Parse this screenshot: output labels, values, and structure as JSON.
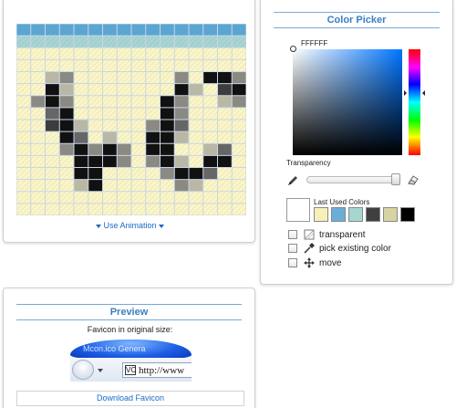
{
  "editor": {
    "use_animation_label": "Use Animation",
    "grid": {
      "cols": 16,
      "rows": 16,
      "background_rows": [
        "blue",
        "teal",
        "cream",
        "cream",
        "cream",
        "cream",
        "cream",
        "cream",
        "cream",
        "cream",
        "cream",
        "cream",
        "cream",
        "cream",
        "cream",
        "cream"
      ],
      "pixels": [
        "................",
        "................",
        "................",
        "................",
        "..HG.......G.KKG",
        "..KH.......KH.LK",
        ".GKG......KG..HG",
        "..MK......KG....",
        "..LKH....GKM....",
        "...KM.H..KKH....",
        "...GKGKG.KK..HM.",
        "....KKKG.GKH.KK.",
        "....KK....GKKM..",
        "....HK.....GH...",
        "................",
        "................"
      ]
    }
  },
  "picker": {
    "title": "Color Picker",
    "hex_value": "FFFFFF",
    "transparency_label": "Transparency",
    "last_used_label": "Last Used Colors",
    "last_used_colors": [
      "#f6f0b9",
      "#6aaed8",
      "#a5d6d0",
      "#3f3f3f",
      "#d7d4a3",
      "#000000"
    ],
    "options": [
      {
        "label": "transparent",
        "icon": "transparent-icon"
      },
      {
        "label": "pick existing color",
        "icon": "eyedropper-icon"
      },
      {
        "label": "move",
        "icon": "move-icon"
      }
    ]
  },
  "preview": {
    "title": "Preview",
    "favicon_label": "Favicon in original size:",
    "browser_tab_text": "Mcon.ico Genera",
    "favicon_text": "VC",
    "address_text": "http://www",
    "download_label": "Download Favicon"
  },
  "colors": {
    "accent": "#3a7ec1",
    "link": "#1a6ac9",
    "grid_blue": "#5aa7d6",
    "grid_teal": "#a6d5d3",
    "grid_cream": "#fbf6c8",
    "pixel_K": "#111111",
    "pixel_L": "#3d3d3d",
    "pixel_M": "#666666",
    "pixel_G": "#8a8a82",
    "pixel_H": "#b9b8a5"
  }
}
